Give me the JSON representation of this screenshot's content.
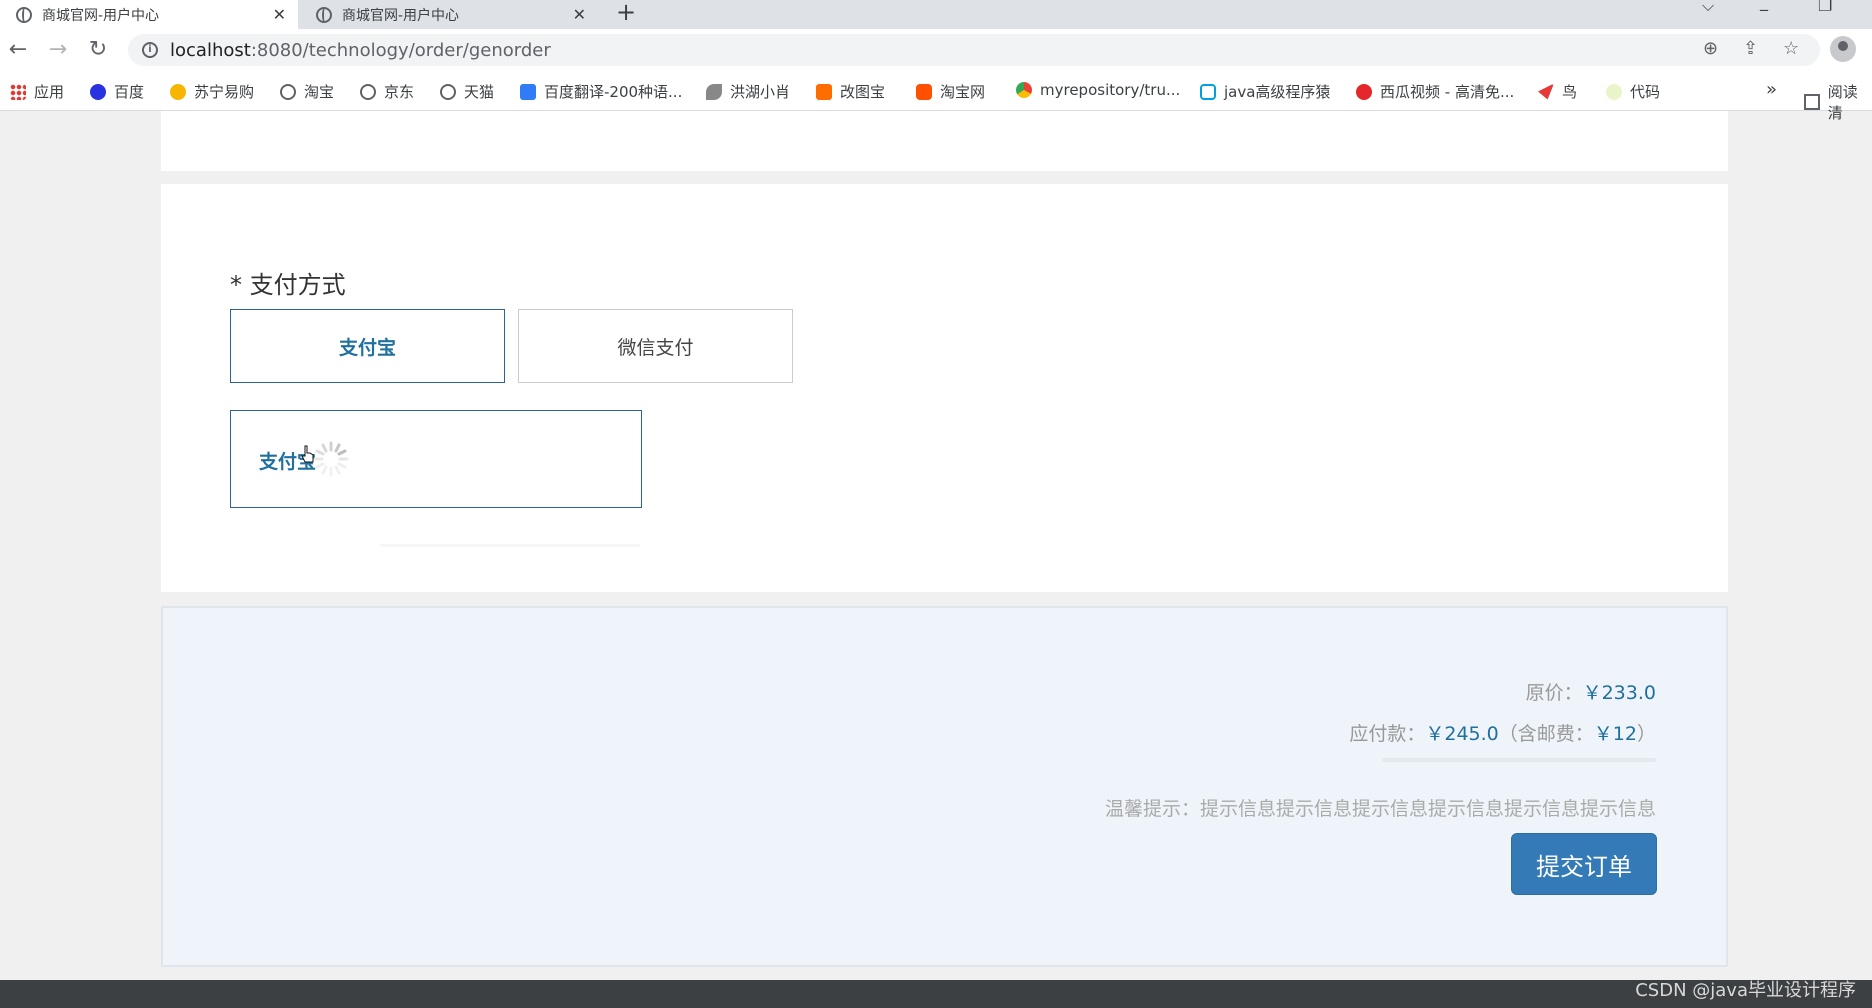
{
  "tabs": [
    {
      "title": "商城官网-用户中心"
    },
    {
      "title": "商城官网-用户中心"
    }
  ],
  "address": {
    "host": "localhost",
    "path": ":8080/technology/order/genorder"
  },
  "bookmarks": {
    "items": [
      {
        "label": "应用",
        "icon": "apps-grid-icon",
        "color": "#e53935"
      },
      {
        "label": "百度",
        "icon": "baidu-paw-icon",
        "color": "#2932e1"
      },
      {
        "label": "苏宁易购",
        "icon": "suning-icon",
        "color": "#f7b500"
      },
      {
        "label": "淘宝",
        "icon": "globe-icon",
        "color": "#5f6368"
      },
      {
        "label": "京东",
        "icon": "globe-icon",
        "color": "#5f6368"
      },
      {
        "label": "天猫",
        "icon": "globe-icon",
        "color": "#5f6368"
      },
      {
        "label": "百度翻译-200种语...",
        "icon": "translate-icon",
        "color": "#2f7cf6"
      },
      {
        "label": "洪湖小肖",
        "icon": "bird-icon",
        "color": "#555555"
      },
      {
        "label": "改图宝",
        "icon": "image-tool-icon",
        "color": "#ff6d00"
      },
      {
        "label": "淘宝网",
        "icon": "taobao-icon",
        "color": "#ff5000"
      },
      {
        "label": "myrepository/tru...",
        "icon": "chrome-icon",
        "color": "#34a853"
      },
      {
        "label": "java高级程序猿",
        "icon": "bilibili-icon",
        "color": "#00a1d6"
      },
      {
        "label": "西瓜视频 - 高清免...",
        "icon": "xigua-icon",
        "color": "#e5262b"
      },
      {
        "label": "鸟",
        "icon": "bird-red-icon",
        "color": "#e53935"
      },
      {
        "label": "代码",
        "icon": "code-icon",
        "color": "#c6e48b"
      }
    ],
    "more": "»",
    "reading_list": "阅读清"
  },
  "payment": {
    "title": "* 支付方式",
    "options": [
      {
        "label": "支付宝",
        "selected": true
      },
      {
        "label": "微信支付",
        "selected": false
      }
    ],
    "detail_label": "支付宝"
  },
  "summary": {
    "original_label": "原价：",
    "original_value": "￥233.0",
    "payable_label": "应付款：",
    "payable_value": "￥245.0",
    "shipping_prefix": "（含邮费：",
    "shipping_value": "￥12",
    "shipping_suffix": "）",
    "tip": "温馨提示：提示信息提示信息提示信息提示信息提示信息提示信息",
    "submit": "提交订单"
  },
  "watermark": "CSDN @java毕业设计程序",
  "colors": {
    "accent": "#337ab7",
    "link_blue": "#1f6f9f",
    "summary_bg": "#eef4f9"
  }
}
